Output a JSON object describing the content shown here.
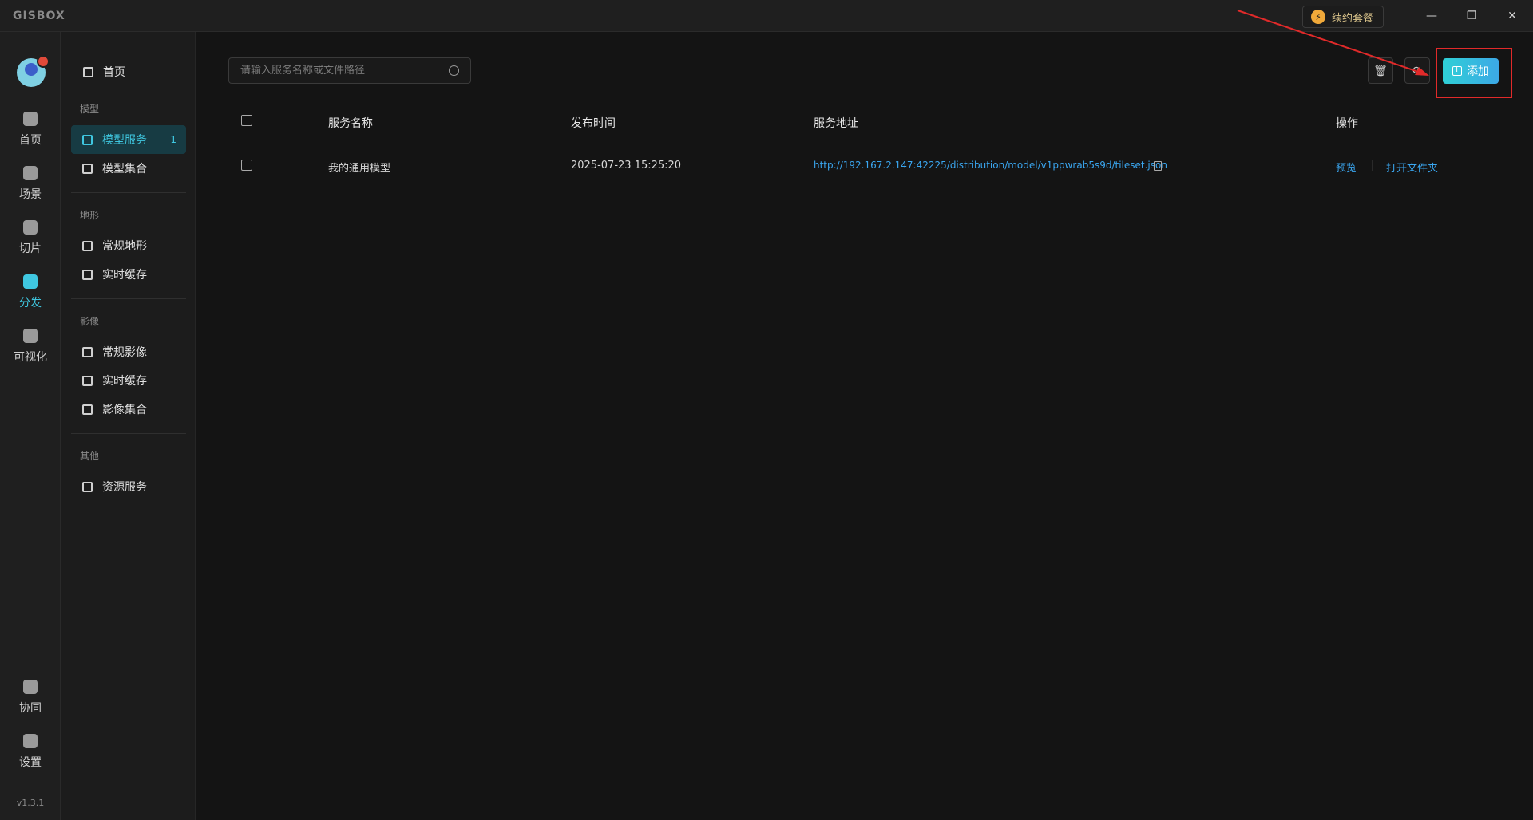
{
  "titlebar": {
    "logo": "GISBOX",
    "renew_label": "续约套餐",
    "renew_icon": "lightning-icon"
  },
  "rail": {
    "items": [
      {
        "label": "首页",
        "icon": "home-icon"
      },
      {
        "label": "场景",
        "icon": "cube-icon"
      },
      {
        "label": "切片",
        "icon": "slice-icon"
      },
      {
        "label": "分发",
        "icon": "distribute-icon",
        "active": true
      },
      {
        "label": "可视化",
        "icon": "chart-icon"
      }
    ],
    "bottom": [
      {
        "label": "协同",
        "icon": "lock-icon"
      },
      {
        "label": "设置",
        "icon": "gear-icon"
      }
    ],
    "version": "v1.3.1"
  },
  "sidebar": {
    "home": "首页",
    "groups": [
      {
        "title": "模型",
        "items": [
          {
            "label": "模型服务",
            "count": "1",
            "active": true
          },
          {
            "label": "模型集合"
          }
        ]
      },
      {
        "title": "地形",
        "items": [
          {
            "label": "常规地形"
          },
          {
            "label": "实时缓存"
          }
        ]
      },
      {
        "title": "影像",
        "items": [
          {
            "label": "常规影像"
          },
          {
            "label": "实时缓存"
          },
          {
            "label": "影像集合"
          }
        ]
      },
      {
        "title": "其他",
        "items": [
          {
            "label": "资源服务"
          }
        ]
      }
    ]
  },
  "toolbar": {
    "search_placeholder": "请输入服务名称或文件路径",
    "add_label": "添加"
  },
  "table": {
    "headers": [
      "服务名称",
      "发布时间",
      "服务地址",
      "操作"
    ],
    "rows": [
      {
        "name": "我的通用模型",
        "time": "2025-07-23 15:25:20",
        "url": "http://192.167.2.147:42225/distribution/model/v1ppwrab5s9d/tileset.json",
        "actions": [
          "预览",
          "打开文件夹"
        ]
      }
    ]
  },
  "colors": {
    "accent": "#3fc7e0",
    "link": "#3aa6f0",
    "annotation": "#e12a2a"
  }
}
